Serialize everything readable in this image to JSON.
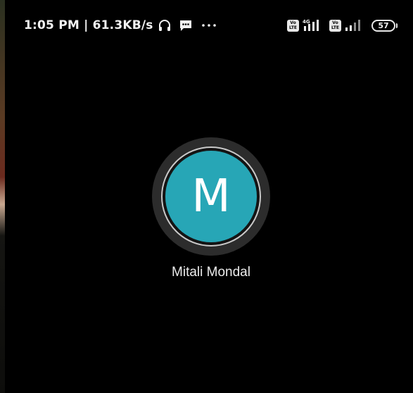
{
  "status_bar": {
    "time_speed": "1:05 PM | 61.3KB/s",
    "volte_1": "Vo LTE",
    "network_type": "4G",
    "volte_2": "Vo LTE",
    "battery_level": "57",
    "icons": [
      "headset-icon",
      "message-icon",
      "more-dots-icon",
      "volte-icon",
      "signal-icon",
      "battery-icon"
    ]
  },
  "contact": {
    "initial": "M",
    "name": "Mitali Mondal",
    "avatar_color": "#27a6b6"
  }
}
